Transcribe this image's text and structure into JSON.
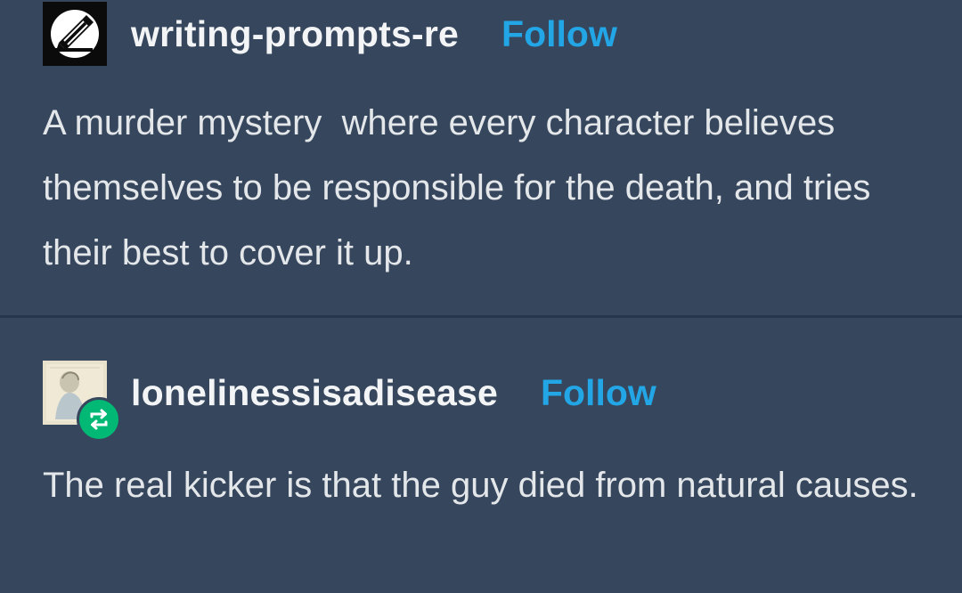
{
  "posts": [
    {
      "username": "writing-prompts-re",
      "follow_label": "Follow",
      "avatar_icon": "pen-writing-icon",
      "text": "A murder mystery  where every character believes themselves to be responsible for the death, and tries their best to cover it up."
    },
    {
      "username": "lonelinessisadisease",
      "follow_label": "Follow",
      "avatar_icon": "sketch-portrait-avatar",
      "badge_icon": "reblog-icon",
      "text": "The real kicker is that the guy died from natural causes."
    }
  ],
  "colors": {
    "background": "#36465d",
    "accent": "#22a6e6",
    "reblog": "#02b875",
    "text": "#e4e7ea"
  }
}
